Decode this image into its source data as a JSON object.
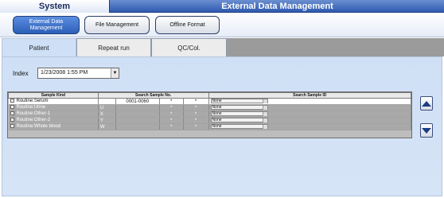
{
  "title": {
    "left": "System",
    "right": "External Data Management"
  },
  "toolbar": {
    "external_data_management": "External Data Management",
    "file_management": "File Management",
    "offline_format": "Offline Format"
  },
  "tabs": [
    {
      "label": "Patient",
      "active": true
    },
    {
      "label": "Repeat run",
      "active": false
    },
    {
      "label": "QC/Col.",
      "active": false
    }
  ],
  "index": {
    "label": "Index",
    "value": "1/23/2008 1:55 PM"
  },
  "table": {
    "headers": [
      "Sample Kind",
      "Search Sample No.",
      "Search Sample ID"
    ],
    "rows": [
      {
        "kind": "Routine:Serum",
        "prefix": "",
        "range": "0001-0060",
        "star1": "*",
        "star2": "*",
        "id": "None"
      },
      {
        "kind": "Routine:Urine",
        "prefix": "U",
        "range": "",
        "star1": "*",
        "star2": "*",
        "id": "None"
      },
      {
        "kind": "Routine:Other-1",
        "prefix": "X",
        "range": "",
        "star1": "*",
        "star2": "*",
        "id": "None"
      },
      {
        "kind": "Routine:Other-2",
        "prefix": "Y",
        "range": "",
        "star1": "*",
        "star2": "*",
        "id": "None"
      },
      {
        "kind": "Routine:Whole blood",
        "prefix": "W",
        "range": "",
        "star1": "*",
        "star2": "*",
        "id": "None"
      }
    ]
  },
  "icons": {
    "scroll_up": "arrow-up-icon",
    "scroll_down": "arrow-down-icon"
  },
  "colors": {
    "accent": "#2c5fb8",
    "title_bar": "#2f5ab0",
    "panel": "#cfdff5"
  }
}
